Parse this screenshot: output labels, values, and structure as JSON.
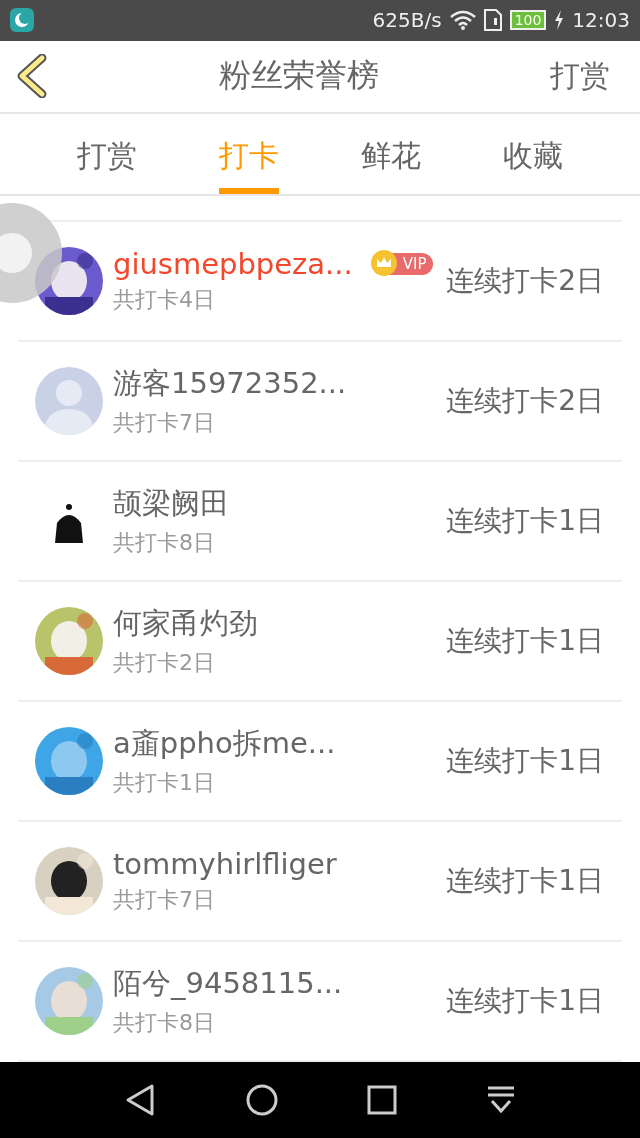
{
  "status_bar": {
    "speed": "625B/s",
    "battery": "100",
    "time": "12:03"
  },
  "header": {
    "title": "粉丝荣誉榜",
    "action": "打赏"
  },
  "tabs": [
    {
      "label": "打赏",
      "selected": false
    },
    {
      "label": "打卡",
      "selected": true
    },
    {
      "label": "鲜花",
      "selected": false
    },
    {
      "label": "收藏",
      "selected": false
    }
  ],
  "rows": [
    {
      "name": "giusmepbpeza...",
      "vip": true,
      "badge": "VIP",
      "total": "共打卡4日",
      "streak": "连续打卡2日"
    },
    {
      "name": "游客15972352...",
      "vip": false,
      "total": "共打卡7日",
      "streak": "连续打卡2日",
      "avatar": {
        "kind": "default"
      }
    },
    {
      "name": "颉梁阙田",
      "vip": false,
      "total": "共打卡8日",
      "streak": "连续打卡1日",
      "avatar": {
        "kind": "figure"
      }
    },
    {
      "name": "何家甬灼劲",
      "vip": false,
      "total": "共打卡2日",
      "streak": "连续打卡1日"
    },
    {
      "name": "a齑ppho拆me...",
      "vip": false,
      "total": "共打卡1日",
      "streak": "连续打卡1日"
    },
    {
      "name": "tommyhirlfliger",
      "vip": false,
      "total": "共打卡7日",
      "streak": "连续打卡1日"
    },
    {
      "name": "陌兮_9458115...",
      "vip": false,
      "total": "共打卡8日",
      "streak": "连续打卡1日"
    }
  ]
}
